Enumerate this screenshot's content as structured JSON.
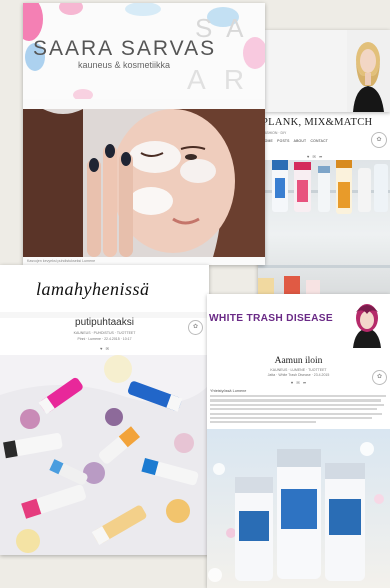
{
  "collage": {
    "cards": [
      {
        "blog_title": "PLANK, MIX&MATCH",
        "kicker": "FASHION · DIY",
        "nav": [
          "HOME",
          "POSTS",
          "ABOUT",
          "CONTACT"
        ],
        "icons": [
          "heart-icon",
          "comment-icon",
          "share-icon"
        ],
        "photo": "skincare bottles on a glass shelf"
      },
      {
        "photo": "blonde woman portrait"
      },
      {
        "blog_title": "SAARA SARVAS",
        "subtitle": "kauneus & kosmetiikka",
        "caption": "Kasvojen kevyeksi puhdistukseksi Lumene",
        "photo": "woman with face wash foam winking"
      },
      {
        "blog_title": "lamahyhenissä",
        "post_title": "putipuhtaaksi",
        "meta": "KAUNEUS · PUHDISTUS · TUOTTEET",
        "post_line": "Pinni · Lumene · 22.4.2015 · 10:17",
        "icons": [
          "heart-icon",
          "comment-icon"
        ],
        "photo": "Lumene cleansers among flowers"
      },
      {
        "blog_title": "WHITE TRASH DISEASE",
        "post_title": "Aamun iloin",
        "meta": "KAUNEUS · LUMENE · TUOTTEET",
        "post_line": "Jatta · White Trash Disease · 23.4.2015",
        "icons": [
          "heart-icon",
          "comment-icon",
          "share-icon"
        ],
        "tag": "Yhteistyössä Lumene",
        "photo": "Lumene skincare bottles with bokeh lights"
      }
    ]
  },
  "colors": {
    "page_bg": "#eeece6",
    "wtd_purple": "#6a2a86",
    "lumene_blue": "#2a6db5",
    "accent_pink": "#e8289a"
  }
}
